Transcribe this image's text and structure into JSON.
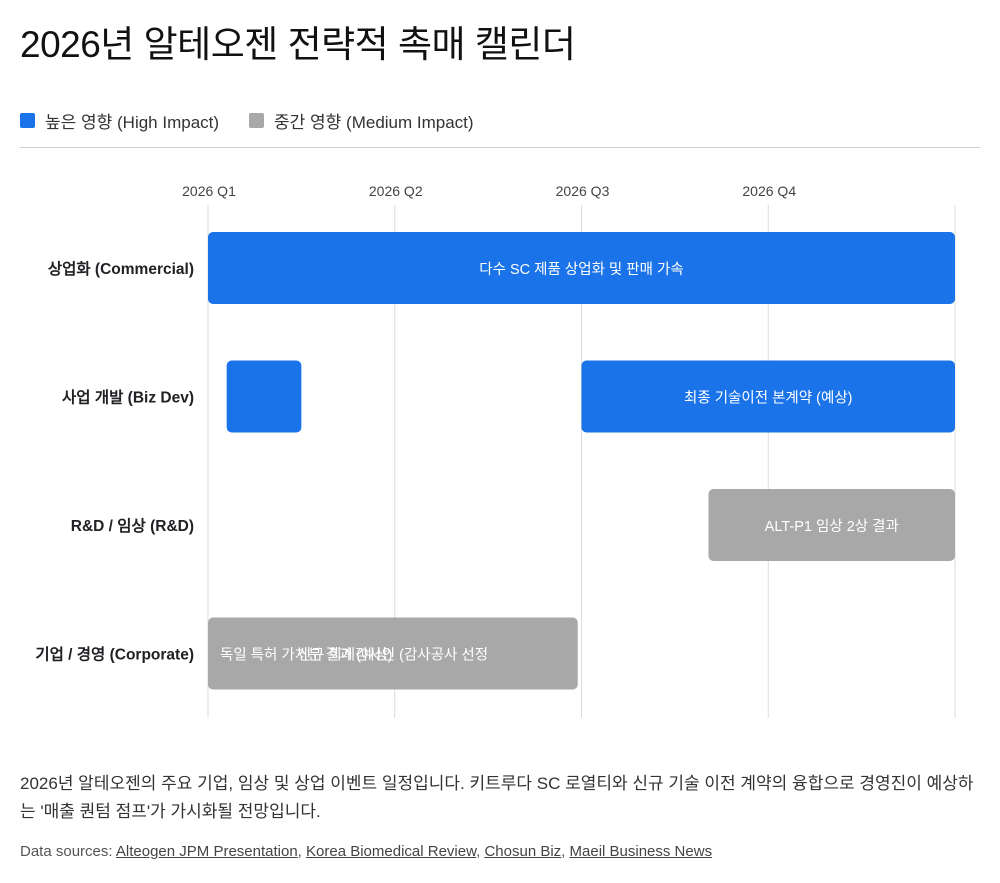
{
  "title": "2026년 알테오젠 전략적 촉매 캘린더",
  "legend": [
    {
      "label": "높은 영향 (High Impact)",
      "color": "#1a73e8"
    },
    {
      "label": "중간 영향 (Medium Impact)",
      "color": "#a8a8a8"
    }
  ],
  "chart_data": {
    "type": "gantt",
    "x_ticks": [
      "2026 Q1",
      "2026 Q2",
      "2026 Q3",
      "2026 Q4"
    ],
    "x_range": [
      0,
      4
    ],
    "grid": true,
    "categories": [
      "상업화 (Commercial)",
      "사업 개발 (Biz Dev)",
      "R&D / 임상 (R&D)",
      "기업 / 경영 (Corporate)"
    ],
    "impact_colors": {
      "high": "#1a73e8",
      "medium": "#a8a8a8"
    },
    "events": [
      {
        "category": 0,
        "label": "다수 SC 제품 상업화 및 판매 가속",
        "start": 0.0,
        "end": 4.0,
        "impact": "high"
      },
      {
        "category": 1,
        "label": "",
        "start": 0.1,
        "end": 0.5,
        "impact": "high"
      },
      {
        "category": 1,
        "label": "최종 기술이전 본계약 (예상)",
        "start": 2.0,
        "end": 4.0,
        "impact": "high"
      },
      {
        "category": 2,
        "label": "ALT-P1 임상 2상 결과",
        "start": 2.68,
        "end": 4.0,
        "impact": "medium"
      },
      {
        "category": 3,
        "label": "독일 특허 가처분 결과 (예상)",
        "start": 0.0,
        "end": 1.98,
        "impact": "medium",
        "align": "left"
      },
      {
        "category": 3,
        "label": "신규 회계감사인 (감사공사 선정",
        "start": 0.0,
        "end": 1.98,
        "impact": "medium"
      }
    ]
  },
  "description": "2026년 알테오젠의 주요 기업, 임상 및 상업 이벤트 일정입니다. 키트루다 SC 로열티와 신규 기술 이전 계약의 융합으로 경영진이 예상하는 '매출 퀀텀 점프'가 가시화될 전망입니다.",
  "sources": {
    "prefix": "Data sources: ",
    "links": [
      "Alteogen JPM Presentation",
      "Korea Biomedical Review",
      "Chosun Biz",
      "Maeil Business News"
    ]
  }
}
